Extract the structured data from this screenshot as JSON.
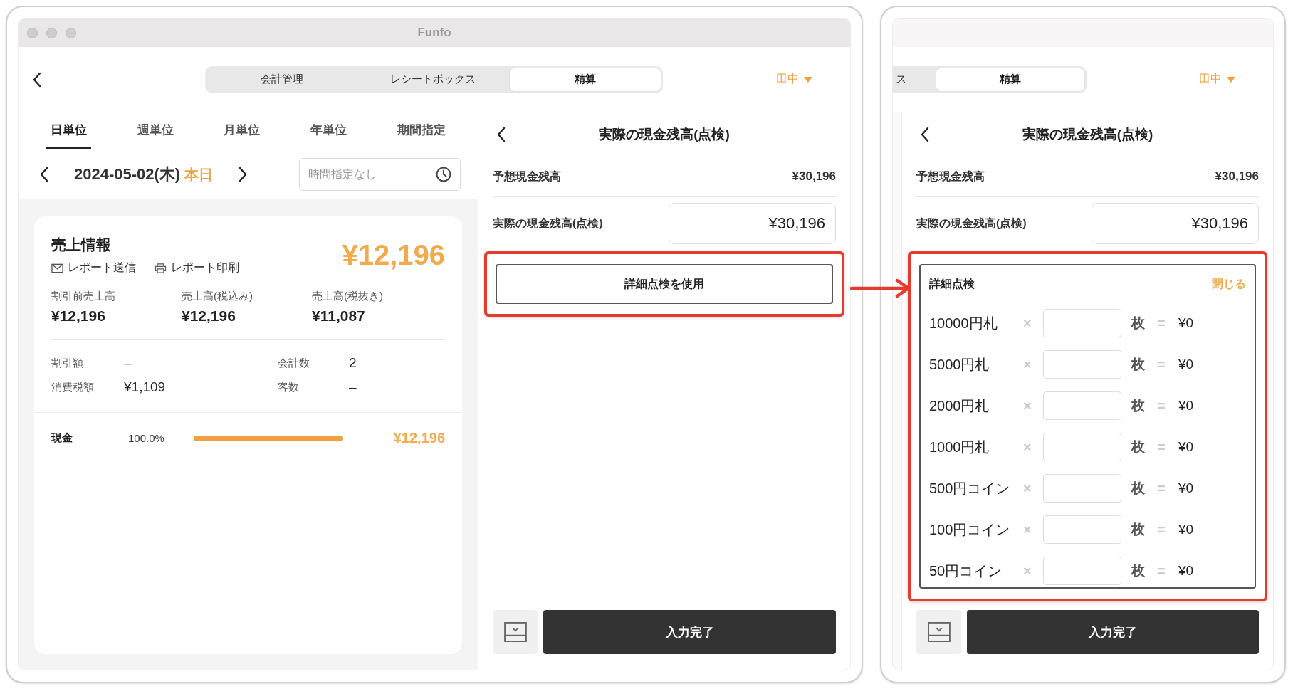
{
  "windows": [
    {
      "title": "Funfo",
      "header": {
        "tabs": [
          {
            "label": "会計管理",
            "selected": false
          },
          {
            "label": "レシートボックス",
            "selected": false
          },
          {
            "label": "精算",
            "selected": true
          }
        ],
        "user": "田中"
      },
      "report": {
        "period_tabs": [
          {
            "label": "日単位",
            "selected": true
          },
          {
            "label": "週単位",
            "selected": false
          },
          {
            "label": "月単位",
            "selected": false
          },
          {
            "label": "年単位",
            "selected": false
          },
          {
            "label": "期間指定",
            "selected": false
          }
        ],
        "date": "2024-05-02(木)",
        "today": "本日",
        "time_placeholder": "時間指定なし",
        "sales": {
          "title": "売上情報",
          "total": "¥12,196",
          "links": [
            {
              "kind": "mail",
              "label": "レポート送信"
            },
            {
              "kind": "print",
              "label": "レポート印刷"
            }
          ],
          "metrics": [
            {
              "label": "割引前売上高",
              "value": "¥12,196"
            },
            {
              "label": "売上高(税込み)",
              "value": "¥12,196"
            },
            {
              "label": "売上高(税抜き)",
              "value": "¥11,087"
            }
          ],
          "details": [
            {
              "label": "割引額",
              "value": "–"
            },
            {
              "label": "会計数",
              "value": "2"
            },
            {
              "label": "消費税額",
              "value": "¥1,109"
            },
            {
              "label": "客数",
              "value": "–"
            }
          ],
          "payments": [
            {
              "method": "現金",
              "share": "100.0%",
              "level": 1,
              "amount": "¥12,196"
            }
          ]
        }
      },
      "settlement": {
        "title": "実際の現金残高(点検)",
        "expected_label": "予想現金残高",
        "expected_value": "¥30,196",
        "actual_label": "実際の現金残高(点検)",
        "actual_value": "¥30,196",
        "detail_button": {
          "label": "詳細点検を使用",
          "highlighted": true
        },
        "submit": "入力完了"
      }
    },
    {
      "header": {
        "tabs": [
          {
            "label": "ス",
            "selected": false
          },
          {
            "label": "精算",
            "selected": true
          }
        ],
        "user": "田中"
      },
      "settlement": {
        "title": "実際の現金残高(点検)",
        "expected_label": "予想現金残高",
        "expected_value": "¥30,196",
        "actual_label": "実際の現金残高(点検)",
        "actual_value": "¥30,196",
        "detail_check": {
          "title": "詳細点検",
          "close": "閉じる",
          "highlighted": true,
          "rows": [
            {
              "denomination": "10000円札",
              "times": "×",
              "unit": "枚",
              "equals": "=",
              "amount": "¥0"
            },
            {
              "denomination": "5000円札",
              "times": "×",
              "unit": "枚",
              "equals": "=",
              "amount": "¥0"
            },
            {
              "denomination": "2000円札",
              "times": "×",
              "unit": "枚",
              "equals": "=",
              "amount": "¥0"
            },
            {
              "denomination": "1000円札",
              "times": "×",
              "unit": "枚",
              "equals": "=",
              "amount": "¥0"
            },
            {
              "denomination": "500円コイン",
              "times": "×",
              "unit": "枚",
              "equals": "=",
              "amount": "¥0"
            },
            {
              "denomination": "100円コイン",
              "times": "×",
              "unit": "枚",
              "equals": "=",
              "amount": "¥0"
            },
            {
              "denomination": "50円コイン",
              "times": "×",
              "unit": "枚",
              "equals": "=",
              "amount": "¥0"
            }
          ]
        },
        "submit": "入力完了"
      }
    }
  ]
}
